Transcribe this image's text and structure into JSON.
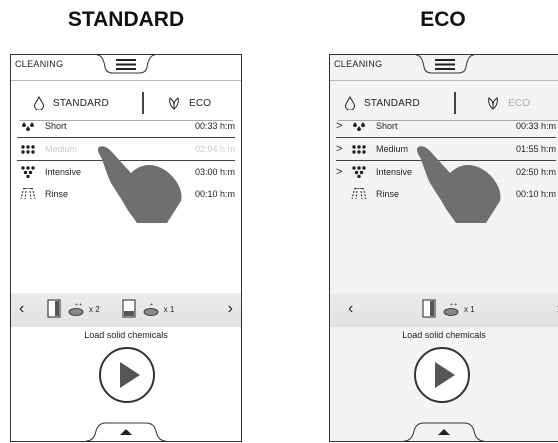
{
  "headings": {
    "left": "STANDARD",
    "right": "ECO"
  },
  "standard": {
    "title": "CLEANING",
    "mode_standard": "STANDARD",
    "mode_eco": "ECO",
    "programs": [
      {
        "name": "Short",
        "time": "00:33 h:m",
        "state": "normal"
      },
      {
        "name": "Medium",
        "time": "02:04 h:m",
        "state": "dim"
      },
      {
        "name": "Intensive",
        "time": "03:00 h:m",
        "state": "normal"
      },
      {
        "name": "Rinse",
        "time": "00:10 h:m",
        "state": "normal"
      }
    ],
    "chem_count_a": "x 2",
    "chem_count_b": "x 1",
    "chem_label": "Load solid chemicals"
  },
  "eco": {
    "title": "CLEANING",
    "mode_standard": "STANDARD",
    "mode_eco": "ECO",
    "programs": [
      {
        "name": "Short",
        "time": "00:33 h:m",
        "chevron": ">"
      },
      {
        "name": "Medium",
        "time": "01:55 h:m",
        "chevron": ">"
      },
      {
        "name": "Intensive",
        "time": "02:50 h:m",
        "chevron": ">"
      },
      {
        "name": "Rinse",
        "time": "00:10 h:m",
        "chevron": ""
      }
    ],
    "chem_count": "x 1",
    "chem_label": "Load solid chemicals"
  },
  "icons": {
    "prev": "chevron-left-icon",
    "next": "chevron-right-icon",
    "play": "play-icon",
    "menu": "hamburger-menu-icon",
    "drop": "water-drop-icon",
    "leaf": "eco-leaf-icon"
  },
  "nav": {
    "prev": "‹",
    "next": "›"
  }
}
